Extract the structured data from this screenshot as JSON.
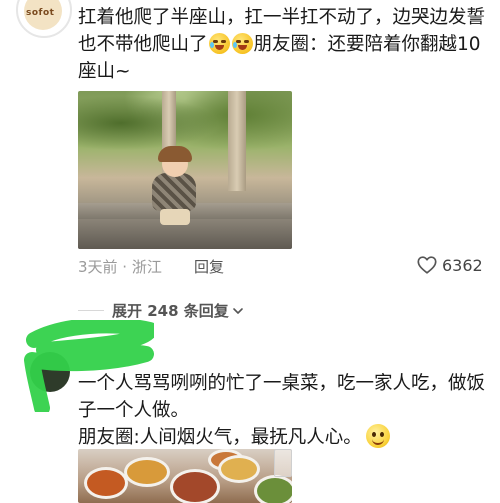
{
  "comment1": {
    "avatar_text": "sofot",
    "lines": [
      "扛着他爬了半座山，扛一半扛不动了，边哭边发誓",
      "也不带他爬山了",
      "座山~"
    ],
    "line2_suffix": "朋友圈：还要陪着你翻越10",
    "meta": "3天前 · 浙江",
    "reply_label": "回复",
    "likes": "6362"
  },
  "expand": {
    "label": "展开 248 条回复"
  },
  "comment2": {
    "lines": [
      "一个人骂骂咧咧的忙了一桌菜，吃一家人吃，做饭",
      "子一个人做。",
      "朋友圈:人间烟火气，最抚凡人心。"
    ]
  },
  "icons": {
    "like": "heart-outline-icon",
    "expand": "chevron-down-icon",
    "emoji_crying": "crying-laughing-emoji-icon",
    "emoji_smile": "smiling-emoji-icon"
  },
  "colors": {
    "text": "#1a1a1a",
    "meta": "#9a9a9a",
    "scribble": "#33d14a"
  }
}
